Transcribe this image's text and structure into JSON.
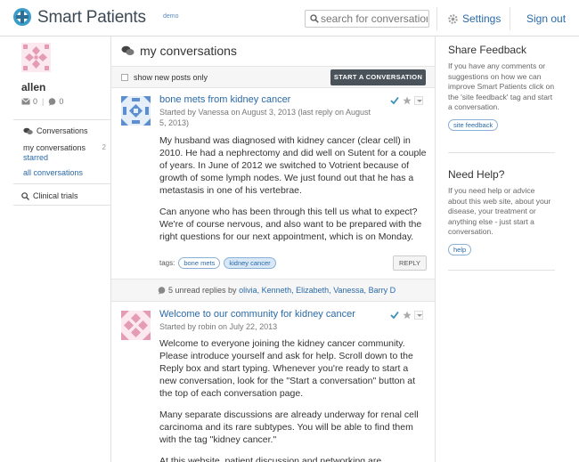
{
  "header": {
    "brand": "Smart Patients",
    "demo_label": "demo",
    "search_placeholder": "search for conversations",
    "settings_label": "Settings",
    "signout_label": "Sign out"
  },
  "sidebar": {
    "username": "allen",
    "messages_count": "0",
    "comments_count": "0",
    "conversations_header": "Conversations",
    "my_conversations": "my conversations",
    "my_conversations_count": "2",
    "starred": "starred",
    "all_conversations": "all conversations",
    "clinical_trials": "Clinical trials"
  },
  "main": {
    "title": "my conversations",
    "show_new_label": "show new posts only",
    "start_button": "START A CONVERSATION",
    "posts": [
      {
        "title": "bone mets from kidney cancer",
        "meta": "Started by Vanessa on August 3, 2013 (last reply on August 5, 2013)",
        "paragraphs": [
          "My husband was diagnosed with kidney cancer (clear cell) in 2010. He had a nephrectomy and did well on Sutent for a couple of years. In June of 2012 we switched to Votrient because of growth of some lymph nodes. We just found out that he has a metastasis in one of his vertebrae.",
          "Can anyone who has been through this tell us what to expect? We're of course nervous, and also want to be prepared with the right questions for our next appointment, which is on Monday."
        ],
        "tags_label": "tags:",
        "tags": [
          "bone mets",
          "kidney cancer"
        ],
        "reply_label": "REPLY",
        "unread_text": "5 unread replies by",
        "unread_names": [
          "olivia,",
          "Kenneth,",
          "Elizabeth,",
          "Vanessa,",
          "Barry D"
        ]
      },
      {
        "title": "Welcome to our community for kidney cancer",
        "meta": "Started by robin on July 22, 2013",
        "paragraphs": [
          "Welcome to everyone joining the kidney cancer community. Please introduce yourself and ask for help. Scroll down to the Reply box and start typing. Whenever you're ready to start a new conversation, look for the \"Start a conversation\" button at the top of each conversation page.",
          "Many separate discussions are already underway for renal cell carcinoma and its rare subtypes. You will be able to find them with the tag \"kidney cancer.\"",
          "At this website, patient discussion and networking are..."
        ]
      }
    ]
  },
  "right": {
    "feedback_title": "Share Feedback",
    "feedback_text": "If you have any comments or suggestions on how we can improve Smart Patients click on the 'site feedback' tag and start a conversation.",
    "feedback_tag": "site feedback",
    "help_title": "Need Help?",
    "help_text": "If you need help or advice about this web site, about your disease, your treatment or anything else - just start a conversation.",
    "help_tag": "help"
  },
  "colors": {
    "link": "#2a6aa8",
    "button_dark": "#4a525a",
    "avatar_pink": "#e59bb3",
    "avatar_blue": "#5b8fd1",
    "check_teal": "#3a8fb8"
  }
}
